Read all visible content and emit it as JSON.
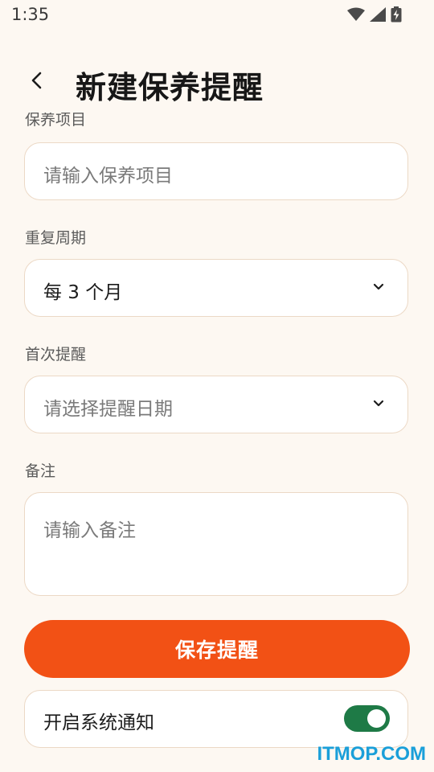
{
  "status_bar": {
    "time": "1:35",
    "icons": [
      "wifi-icon",
      "signal-icon",
      "battery-charging-icon"
    ]
  },
  "header": {
    "back_icon": "chevron-left-icon",
    "title": "新建保养提醒"
  },
  "form": {
    "item": {
      "label": "保养项目",
      "placeholder": "请输入保养项目"
    },
    "repeat": {
      "label": "重复周期",
      "value": "每 3 个月"
    },
    "first_reminder": {
      "label": "首次提醒",
      "placeholder": "请选择提醒日期"
    },
    "notes": {
      "label": "备注",
      "placeholder": "请输入备注"
    }
  },
  "actions": {
    "save_label": "保存提醒"
  },
  "notification": {
    "label": "开启系统通知",
    "enabled": true
  },
  "watermark": "ITMOP.COM",
  "colors": {
    "background": "#fdf8f2",
    "accent": "#f25115",
    "toggle_on": "#1e7a46",
    "border": "#ecd9c6"
  }
}
